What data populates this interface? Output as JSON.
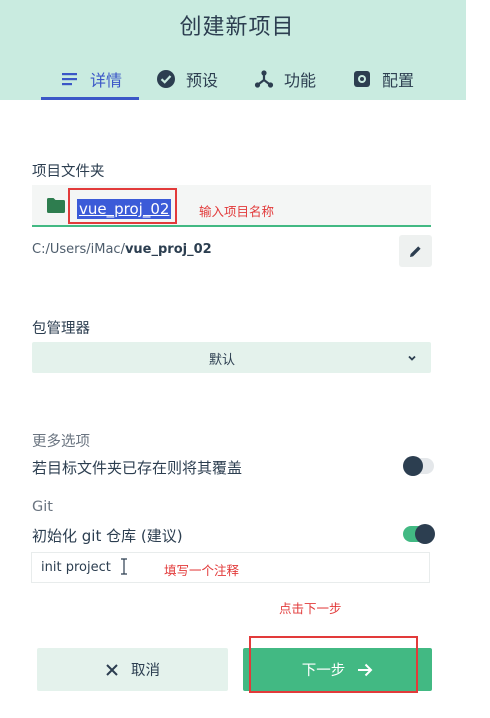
{
  "header": {
    "title": "创建新项目",
    "tabs": [
      {
        "label": "详情",
        "icon": "details-list-icon",
        "active": true
      },
      {
        "label": "预设",
        "icon": "check-circle-icon",
        "active": false
      },
      {
        "label": "功能",
        "icon": "features-icon",
        "active": false
      },
      {
        "label": "配置",
        "icon": "gear-icon",
        "active": false
      }
    ]
  },
  "project": {
    "folder_label": "项目文件夹",
    "folder_value": "vue_proj_02",
    "folder_annotation": "输入项目名称",
    "path_prefix": "C:/Users/iMac/",
    "path_name": "vue_proj_02"
  },
  "package_manager": {
    "label": "包管理器",
    "selected": "默认"
  },
  "more_options": {
    "label": "更多选项",
    "overwrite_label": "若目标文件夹已存在则将其覆盖",
    "overwrite_on": false
  },
  "git": {
    "label": "Git",
    "init_label": "初始化 git 仓库 (建议)",
    "init_on": true,
    "commit_value": "init project",
    "commit_annotation": "填写一个注释"
  },
  "footer": {
    "next_annotation": "点击下一步",
    "cancel_label": "取消",
    "next_label": "下一步"
  },
  "colors": {
    "accent": "#42b983",
    "header_bg": "#c9ebe0",
    "active_tab": "#3b57c7",
    "annotation_red": "#e23a3a"
  }
}
